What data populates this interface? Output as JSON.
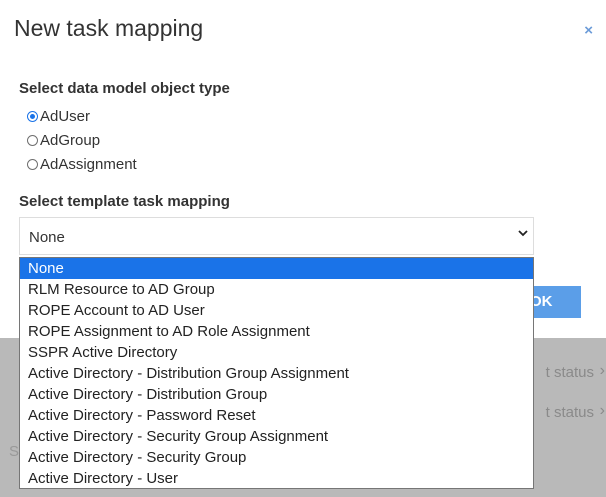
{
  "modal": {
    "title": "New task mapping",
    "close_icon": "×",
    "object_type_label": "Select data model object type",
    "object_types": [
      {
        "label": "AdUser",
        "checked": true
      },
      {
        "label": "AdGroup",
        "checked": false
      },
      {
        "label": "AdAssignment",
        "checked": false
      }
    ],
    "template_label": "Select template task mapping",
    "select_value": "None",
    "select_arrow": "⌄",
    "ok_label": "OK",
    "options": [
      "None",
      "RLM Resource to AD Group",
      "ROPE Account to AD User",
      "ROPE Assignment to AD Role Assignment",
      "SSPR Active Directory",
      "Active Directory - Distribution Group Assignment",
      "Active Directory - Distribution Group",
      "Active Directory - Password Reset",
      "Active Directory - Security Group Assignment",
      "Active Directory - Security Group",
      "Active Directory - User"
    ],
    "selected_option_index": 0
  },
  "background": {
    "status_text": "t status",
    "chevron": "›",
    "s_text": "S"
  },
  "colors": {
    "accent": "#1a73e8",
    "ok_button": "#5b9ee8",
    "backdrop": "#b9b9b9"
  }
}
